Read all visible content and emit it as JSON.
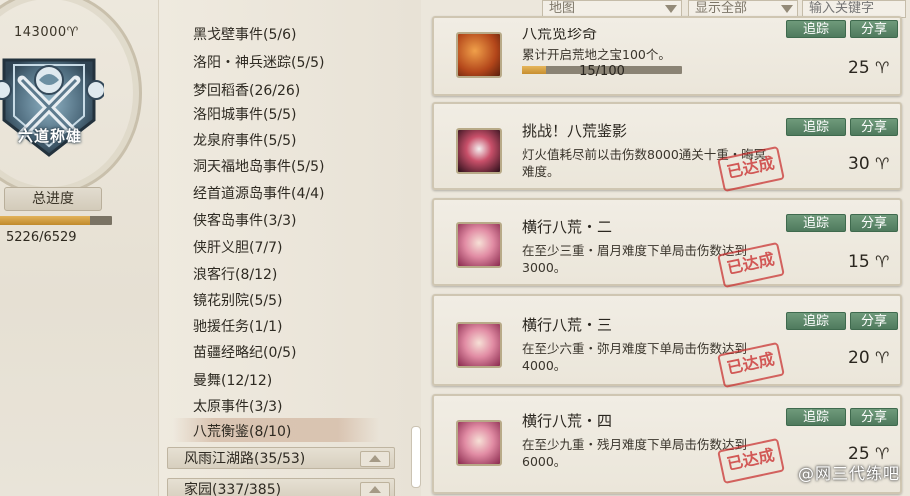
{
  "badge": {
    "score": "143000",
    "title": "六道称雄",
    "progress_button": "总进度",
    "overall_progress": 0.806,
    "overall_count": "5226/6529"
  },
  "categories": [
    "黑戈壁事件(5/6)",
    "洛阳・神兵迷踪(5/5)",
    "梦回稻香(26/26)",
    "洛阳城事件(5/5)",
    "龙泉府事件(5/5)",
    "洞天福地岛事件(5/5)",
    "经首道源岛事件(4/4)",
    "侠客岛事件(3/3)",
    "侠肝义胆(7/7)",
    "浪客行(8/12)",
    "镜花别院(5/5)",
    "驰援任务(1/1)",
    "苗疆经略纪(0/5)",
    "曼舞(12/12)",
    "太原事件(3/3)",
    "八荒衡鉴(8/10)"
  ],
  "groups": [
    "风雨江湖路(35/53)",
    "家园(337/385)"
  ],
  "filters": {
    "map": "地图",
    "show": "显示全部",
    "search_placeholder": "输入关键字"
  },
  "cards": [
    {
      "title": "八荒览珍奇",
      "desc": "累计开启荒地之宝100个。",
      "progress_text": "15/100",
      "progress": 0.15,
      "reward": "25",
      "track": "追踪",
      "share": "分享",
      "completed": false
    },
    {
      "title": "挑战！八荒鉴影",
      "desc": "灯火值耗尽前以击伤数8000通关十重・晦冥难度。",
      "reward": "30",
      "track": "追踪",
      "share": "分享",
      "completed": true
    },
    {
      "title": "横行八荒・二",
      "desc": "在至少三重・眉月难度下单局击伤数达到3000。",
      "reward": "15",
      "track": "追踪",
      "share": "分享",
      "completed": true
    },
    {
      "title": "横行八荒・三",
      "desc": "在至少六重・弥月难度下单局击伤数达到4000。",
      "reward": "20",
      "track": "追踪",
      "share": "分享",
      "completed": true
    },
    {
      "title": "横行八荒・四",
      "desc": "在至少九重・残月难度下单局击伤数达到6000。",
      "reward": "25",
      "track": "追踪",
      "share": "分享",
      "completed": true
    }
  ],
  "stamp_text": "已达成",
  "watermark": "@网三代练吧",
  "colors": {
    "button_green": "#5a8568",
    "stamp_red": "#c82828",
    "progress_gold": "#d49a3a"
  }
}
